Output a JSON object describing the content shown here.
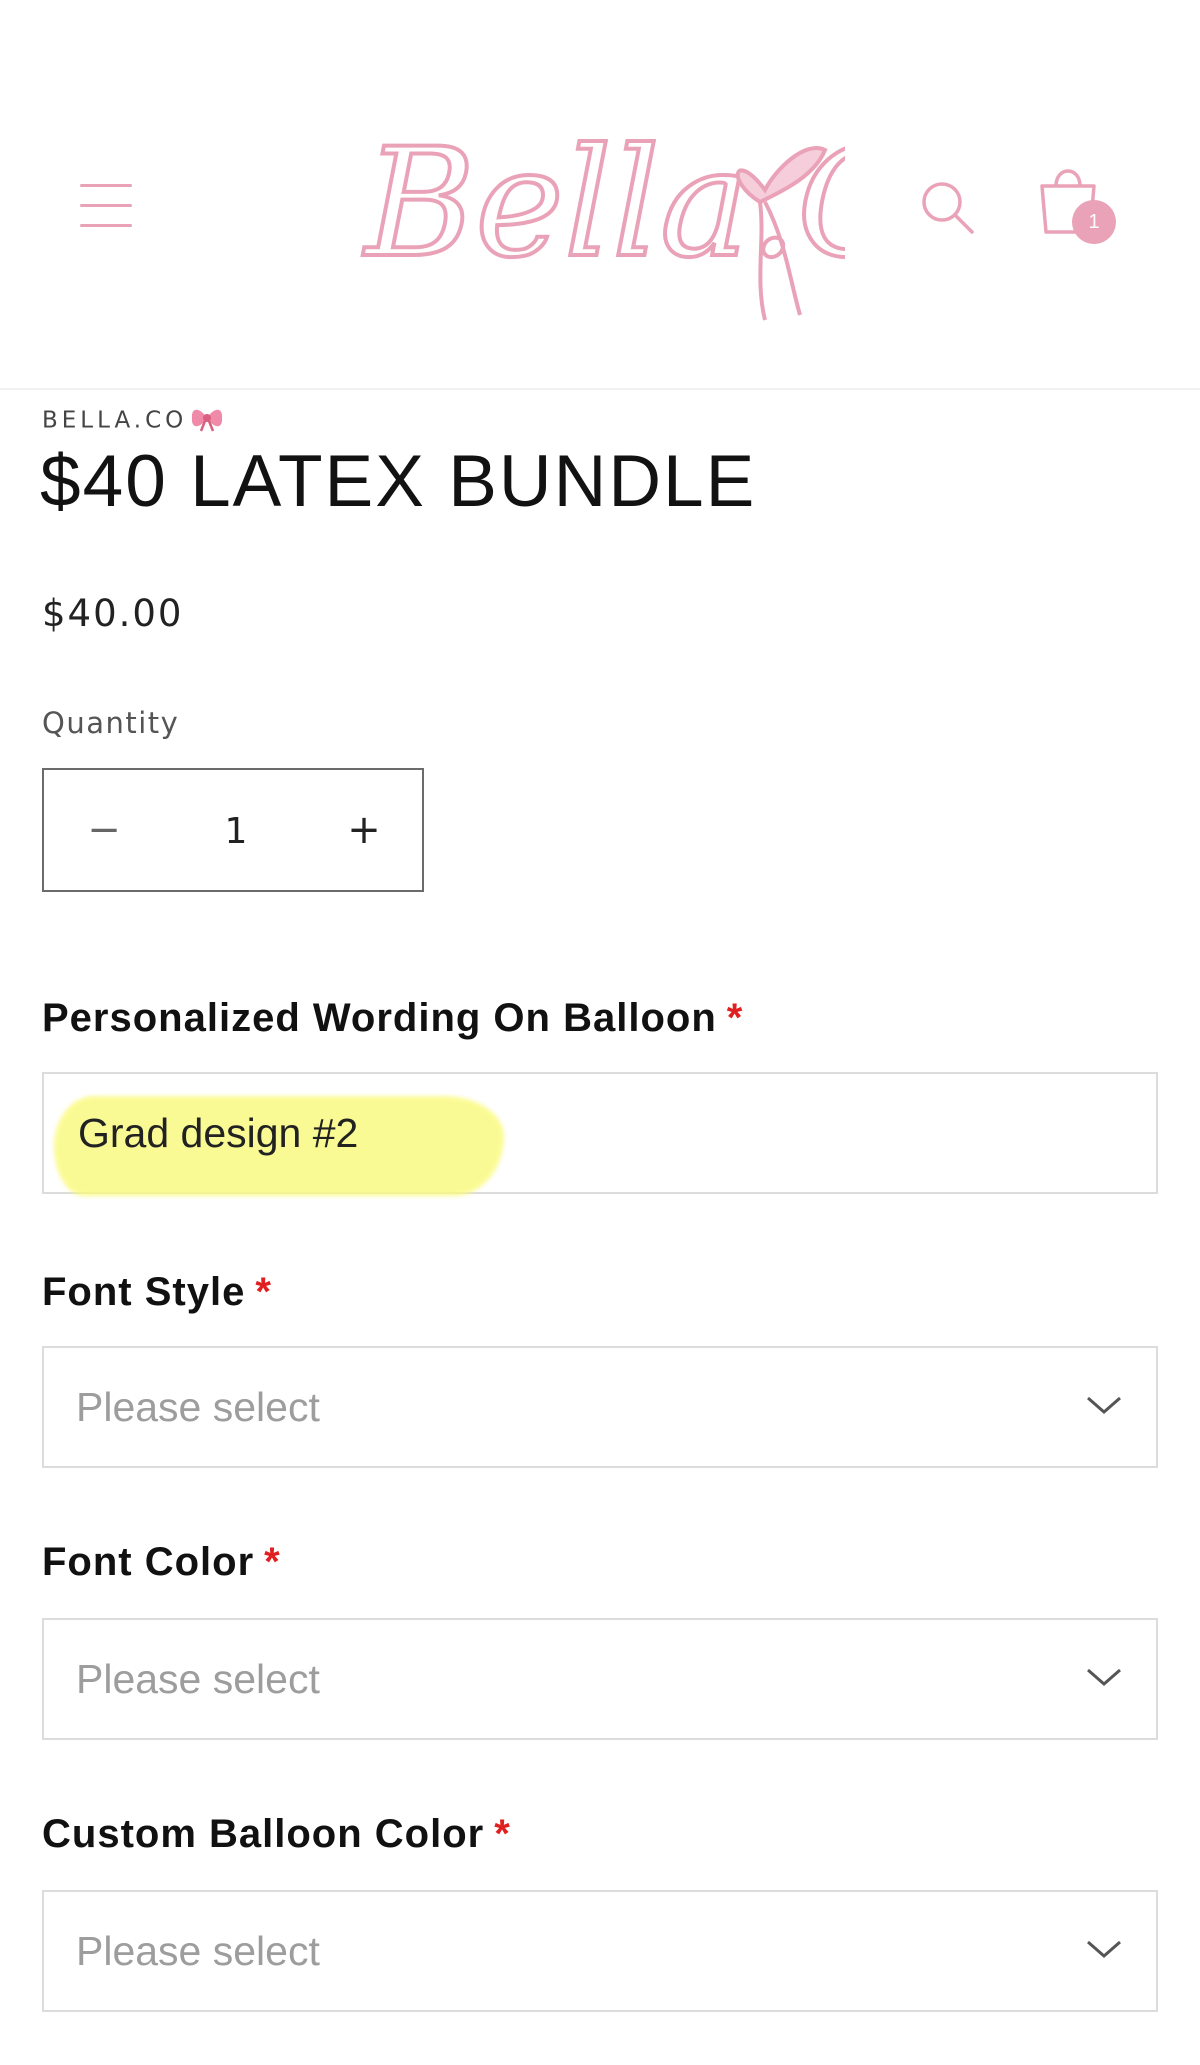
{
  "header": {
    "logo_text": "Bella.Co",
    "cart_count": "1"
  },
  "product": {
    "vendor": "BELLA.CO",
    "title": "$40 LATEX BUNDLE",
    "price": "$40.00"
  },
  "quantity": {
    "label": "Quantity",
    "minus": "−",
    "value": "1",
    "plus": "+"
  },
  "fields": {
    "wording": {
      "label": "Personalized Wording On Balloon",
      "required": "*",
      "value": "Grad design #2"
    },
    "font_style": {
      "label": "Font Style",
      "required": "*",
      "placeholder": "Please select"
    },
    "font_color": {
      "label": "Font Color",
      "required": "*",
      "placeholder": "Please select"
    },
    "balloon_color": {
      "label": "Custom Balloon Color",
      "required": "*",
      "placeholder": "Please select"
    }
  },
  "colors": {
    "brand_pink": "#eaa2b8",
    "required_red": "#e02020",
    "highlight_yellow": "#fafa7a"
  },
  "icons": [
    "menu-icon",
    "search-icon",
    "cart-icon",
    "bow-emoji",
    "chevron-down-icon"
  ]
}
